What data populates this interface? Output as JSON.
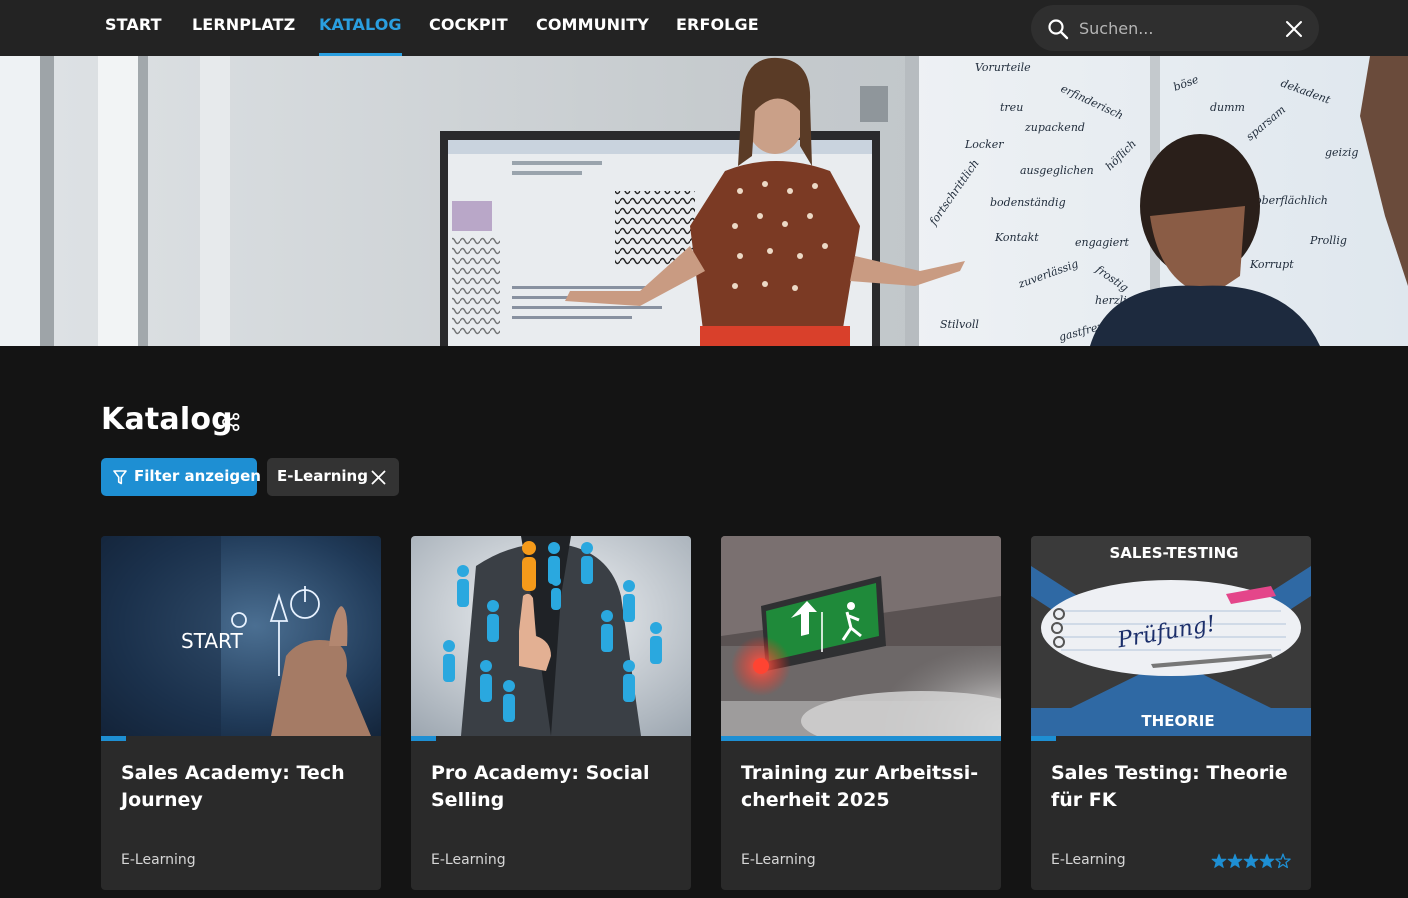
{
  "nav": {
    "items": [
      {
        "label": "START",
        "active": false
      },
      {
        "label": "LERNPLATZ",
        "active": false
      },
      {
        "label": "KATALOG",
        "active": true
      },
      {
        "label": "COCKPIT",
        "active": false
      },
      {
        "label": "COMMUNITY",
        "active": false
      },
      {
        "label": "ERFOLGE",
        "active": false
      }
    ],
    "search": {
      "placeholder": "Suchen...",
      "value": ""
    }
  },
  "hero": {
    "alt": "Presenter in front of screen and whiteboard",
    "whiteboard_words": [
      "Vorurteile",
      "erfinderisch",
      "böse",
      "dekadent",
      "treu",
      "zupackend",
      "dumm",
      "sparsam",
      "geizig",
      "Locker",
      "ausgeglichen",
      "höflich",
      "bodenständig",
      "Kontakt",
      "oberflächlich",
      "fortschrittlich",
      "engagiert",
      "Korrupt",
      "zuverlässig",
      "frostig",
      "herzlich",
      "Prollig",
      "Stilvoll",
      "gastfreundlich"
    ]
  },
  "page": {
    "title": "Katalog",
    "filter_button_label": "Filter anzeigen",
    "active_filter_chip": "E-Learning"
  },
  "cards": [
    {
      "title": "Sales Academy: Tech Journey",
      "type": "E-Learning",
      "progress": 0.09,
      "rating": null,
      "image": "rocket-start",
      "image_text": "START"
    },
    {
      "title": "Pro Academy: Social Selling",
      "type": "E-Learning",
      "progress": 0.09,
      "rating": null,
      "image": "network-people",
      "image_text": ""
    },
    {
      "title": "Training zur Arbeitssi­cherheit 2025",
      "type": "E-Learning",
      "progress": 1.0,
      "rating": null,
      "image": "emergency-exit",
      "image_text": ""
    },
    {
      "title": "Sales Testing: Theorie für FK",
      "type": "E-Learning",
      "progress": 0.09,
      "rating": 4,
      "rating_max": 5,
      "image": "sales-testing",
      "image_text_top": "SALES-TESTING",
      "image_text_bottom": "THEORIE",
      "image_text_note": "Prüfung!"
    }
  ],
  "colors": {
    "accent": "#1e8fd3",
    "nav_active": "#2a9fe0",
    "background": "#141414",
    "card": "#2a2a2a",
    "nav_bar": "#232323"
  }
}
